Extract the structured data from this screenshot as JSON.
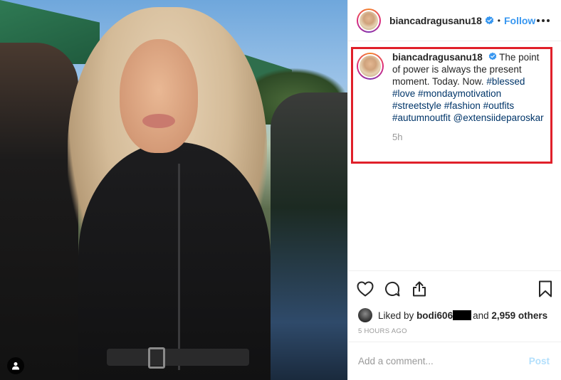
{
  "header": {
    "username": "biancadragusanu18",
    "separator": "•",
    "follow_label": "Follow",
    "more_icon": "more-options-icon",
    "verified_icon": "verified-badge-icon"
  },
  "caption": {
    "username": "biancadragusanu18",
    "text_lead": "The point of power is always the present moment. Today. Now.",
    "tags": [
      "#blessed",
      "#love",
      "#mondaymotivation",
      "#streetstyle",
      "#fashion",
      "#outfits",
      "#autumnoutfit",
      "@extensiideparoskar"
    ],
    "time": "5h"
  },
  "actions": {
    "like_icon": "heart-icon",
    "comment_icon": "comment-icon",
    "share_icon": "share-icon",
    "save_icon": "bookmark-icon"
  },
  "likes": {
    "prefix": "Liked by",
    "user": "bodi606",
    "middle": "and",
    "others": "2,959 others"
  },
  "posted_ago": "5 HOURS AGO",
  "add_comment": {
    "placeholder": "Add a comment...",
    "post_label": "Post"
  },
  "colors": {
    "accent": "#3897f0",
    "highlight": "#e0202a",
    "hashtag": "#003569",
    "muted": "#999999",
    "post_disabled": "#b2dffc"
  }
}
